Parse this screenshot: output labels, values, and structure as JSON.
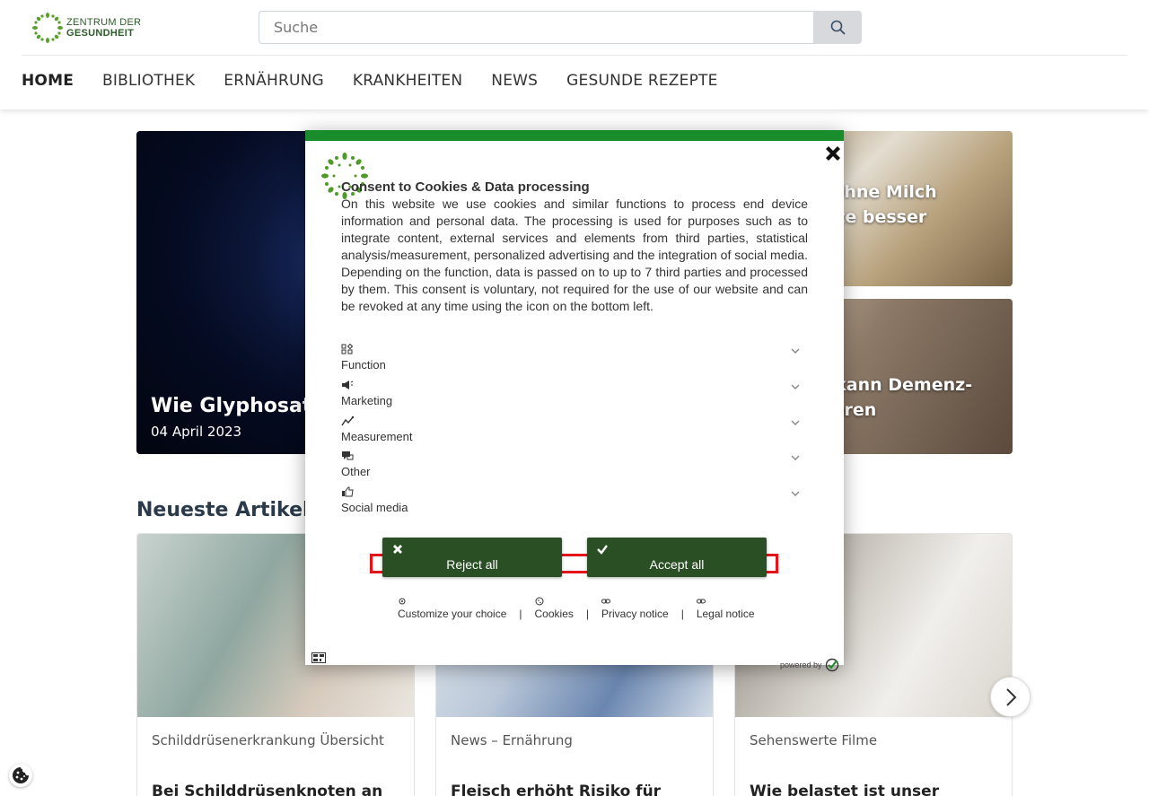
{
  "header": {
    "logo_line1": "ZENTRUM DER",
    "logo_line2": "GESUNDHEIT",
    "search_placeholder": "Suche",
    "nav": [
      "HOME",
      "BIBLIOTHEK",
      "ERNÄHRUNG",
      "KRANKHEITEN",
      "NEWS",
      "GESUNDE REZEPTE"
    ]
  },
  "hero": {
    "main_title": "Wie Glyphosat",
    "main_date": "04 April 2023",
    "right1_title_l1": ": Ohne Milch",
    "right1_title_l2": "erte besser",
    "right2_title_l1": "n kann Demenz-",
    "right2_title_l2": "zieren"
  },
  "section_title": "Neueste Artikel",
  "cards": [
    {
      "category": "Schilddrüsenerkrankung Übersicht",
      "title": "Bei Schilddrüsenknoten an"
    },
    {
      "category": "News – Ernährung",
      "title": "Fleisch erhöht Risiko für"
    },
    {
      "category": "Sehenswerte Filme",
      "title": "Wie belastet ist unser"
    }
  ],
  "consent": {
    "title": "Consent to Cookies & Data processing",
    "body": "On this website we use cookies and similar functions to process end device information and personal data. The processing is used for purposes such as to integrate content, external services and elements from third parties, statistical analysis/measurement, personalized advertising and the integration of social media. Depending on the function, data is passed on to up to 7 third parties and processed by them. This consent is voluntary, not required for the use of our website and can be revoked at any time using the icon on the bottom left.",
    "categories": [
      {
        "label": "Function",
        "icon": "function-icon"
      },
      {
        "label": "Marketing",
        "icon": "megaphone-icon"
      },
      {
        "label": "Measurement",
        "icon": "chart-icon"
      },
      {
        "label": "Other",
        "icon": "chat-icon"
      },
      {
        "label": "Social media",
        "icon": "thumbs-up-icon"
      }
    ],
    "reject_label": "Reject all",
    "accept_label": "Accept all",
    "links": {
      "customize": "Customize your choice",
      "cookies": "Cookies",
      "privacy": "Privacy notice",
      "legal": "Legal notice"
    },
    "separator": "|",
    "powered_by": "powered by",
    "colors": {
      "accent": "#198d2b",
      "button": "#2a4f25",
      "highlight": "#e4141b"
    }
  }
}
